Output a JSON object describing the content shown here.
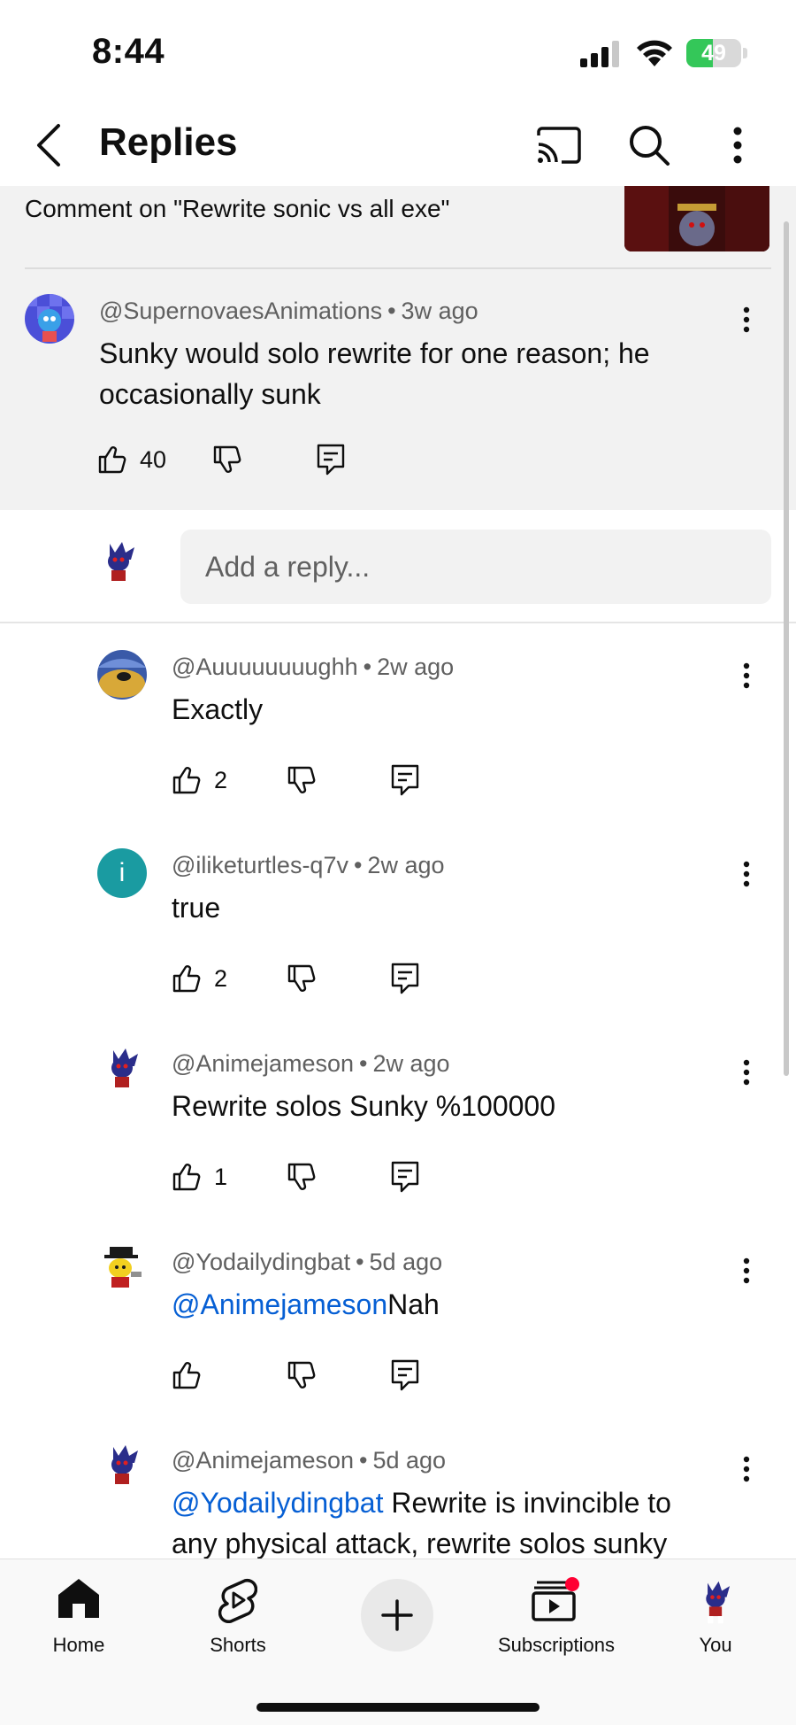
{
  "status_bar": {
    "time": "8:44",
    "battery": "49",
    "battery_level": 0.49
  },
  "header": {
    "title": "Replies"
  },
  "parent": {
    "context": "Comment on \"Rewrite sonic vs all exe\"",
    "author": "@SupernovaesAnimations",
    "age": "3w ago",
    "text": "Sunky would solo rewrite for one reason; he occasionally sunk",
    "likes": "40"
  },
  "reply_input": {
    "placeholder": "Add a reply..."
  },
  "replies": [
    {
      "author": "@Auuuuuuuughh",
      "age": "2w ago",
      "mention": "",
      "text": "Exactly",
      "likes": "2"
    },
    {
      "author": "@iliketurtles-q7v",
      "age": "2w ago",
      "mention": "",
      "text": "true",
      "likes": "2",
      "avatar_letter": "i"
    },
    {
      "author": "@Animejameson",
      "age": "2w ago",
      "mention": "",
      "text": "Rewrite solos Sunky %100000",
      "likes": "1"
    },
    {
      "author": "@Yodailydingbat",
      "age": "5d ago",
      "mention": "@Animejameson",
      "text": "Nah",
      "likes": ""
    },
    {
      "author": "@Animejameson",
      "age": "5d ago",
      "mention": "@Yodailydingbat",
      "text": " Rewrite is invincible to any physical attack, rewrite solos sunky",
      "likes": ""
    }
  ],
  "nav": {
    "home": "Home",
    "shorts": "Shorts",
    "subscriptions": "Subscriptions",
    "you": "You"
  },
  "colors": {
    "mention": "#065fd4",
    "notification": "#ff0033",
    "avatar_teal": "#1a9ba1"
  }
}
